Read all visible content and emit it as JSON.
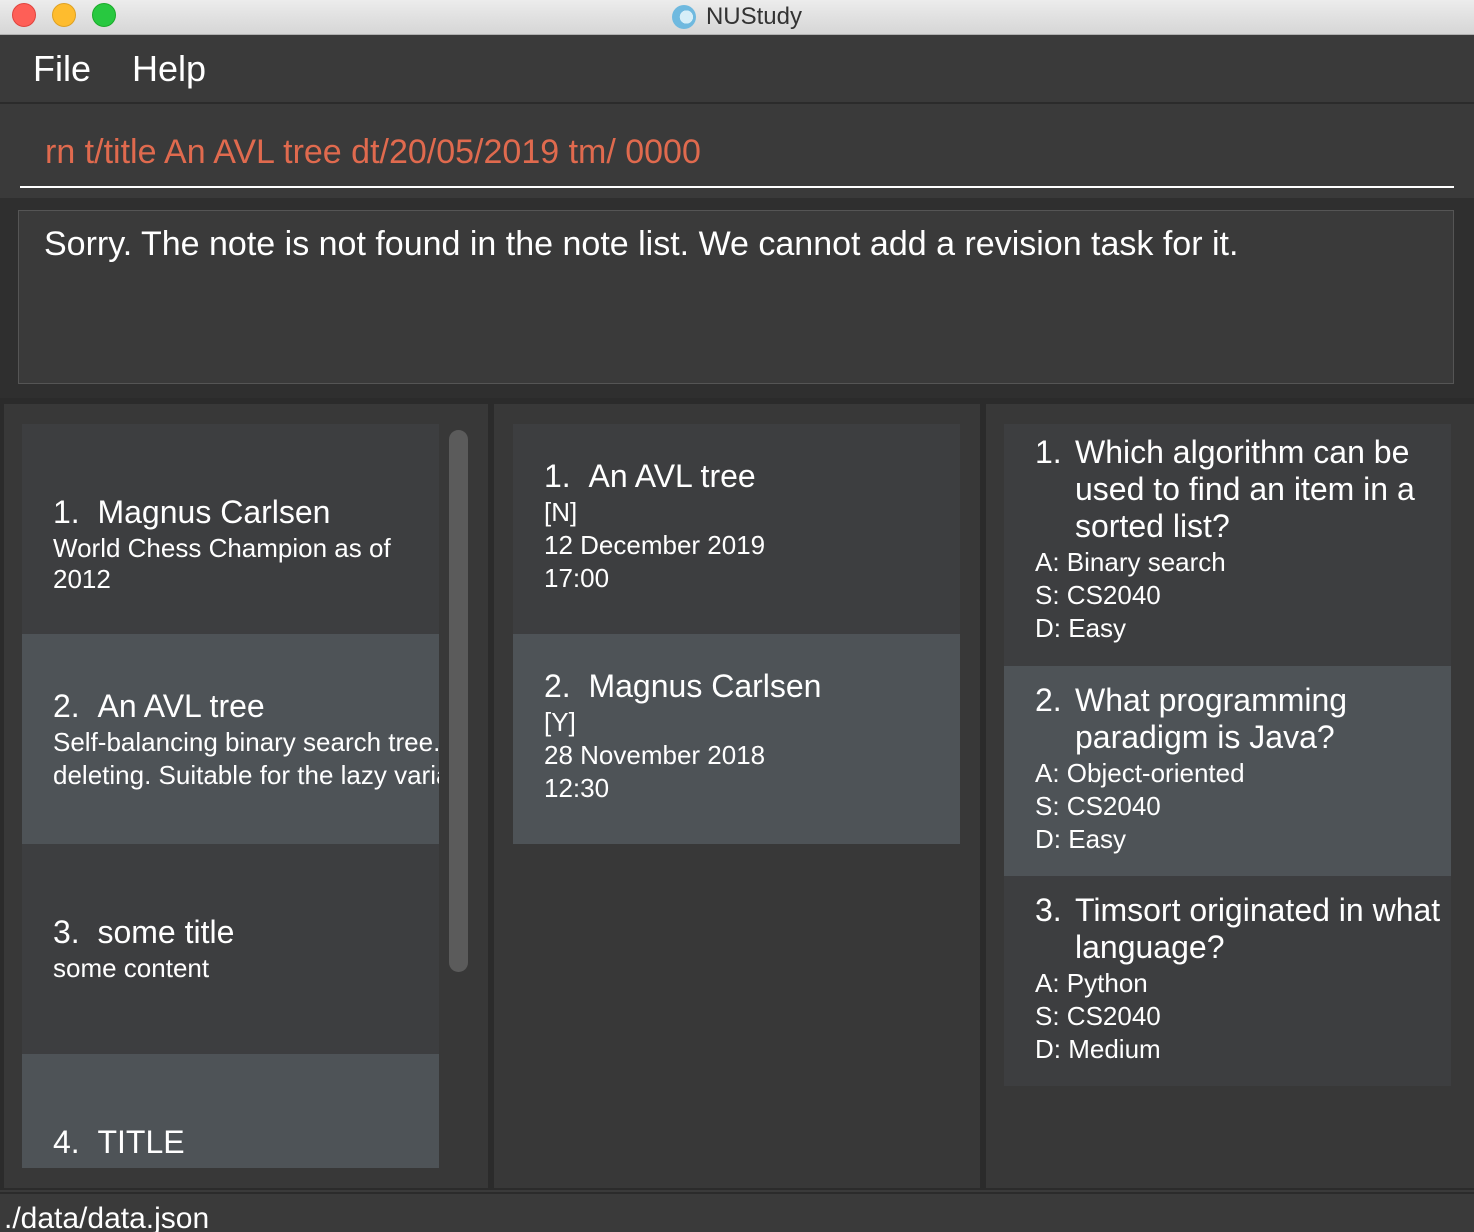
{
  "window": {
    "title": "NUStudy"
  },
  "menu": {
    "file": "File",
    "help": "Help"
  },
  "command": {
    "value": "rn t/title An AVL tree dt/20/05/2019 tm/ 0000"
  },
  "result": {
    "message": "Sorry. The note is not found in the note list. We cannot add a revision task for it."
  },
  "notes": [
    {
      "index": "1.",
      "title": "Magnus Carlsen",
      "content": [
        "World Chess Champion as of 2012"
      ]
    },
    {
      "index": "2.",
      "title": "An AVL tree",
      "content": [
        "Self-balancing binary search tree. N",
        "deleting. Suitable for the lazy variant"
      ]
    },
    {
      "index": "3.",
      "title": "some title",
      "content": [
        "some content"
      ]
    },
    {
      "index": "4.",
      "title": "TITLE",
      "content": []
    }
  ],
  "tasks": [
    {
      "index": "1.",
      "title": "An AVL tree",
      "status": "[N]",
      "date": "12 December 2019",
      "time": "17:00"
    },
    {
      "index": "2.",
      "title": "Magnus Carlsen",
      "status": "[Y]",
      "date": "28 November 2018",
      "time": "12:30"
    }
  ],
  "questions": [
    {
      "index": "1.",
      "question": [
        "Which algorithm can be",
        "used to find an item in a",
        "sorted list?"
      ],
      "answer": "A: Binary search",
      "subject": "S: CS2040",
      "difficulty": "D: Easy"
    },
    {
      "index": "2.",
      "question": [
        "What programming",
        "paradigm is Java?"
      ],
      "answer": "A: Object-oriented",
      "subject": "S: CS2040",
      "difficulty": "D: Easy"
    },
    {
      "index": "3.",
      "question": [
        "Timsort originated in what",
        "language?"
      ],
      "answer": "A: Python",
      "subject": "S: CS2040",
      "difficulty": "D: Medium"
    }
  ],
  "status": {
    "file_path": "./data/data.json"
  }
}
